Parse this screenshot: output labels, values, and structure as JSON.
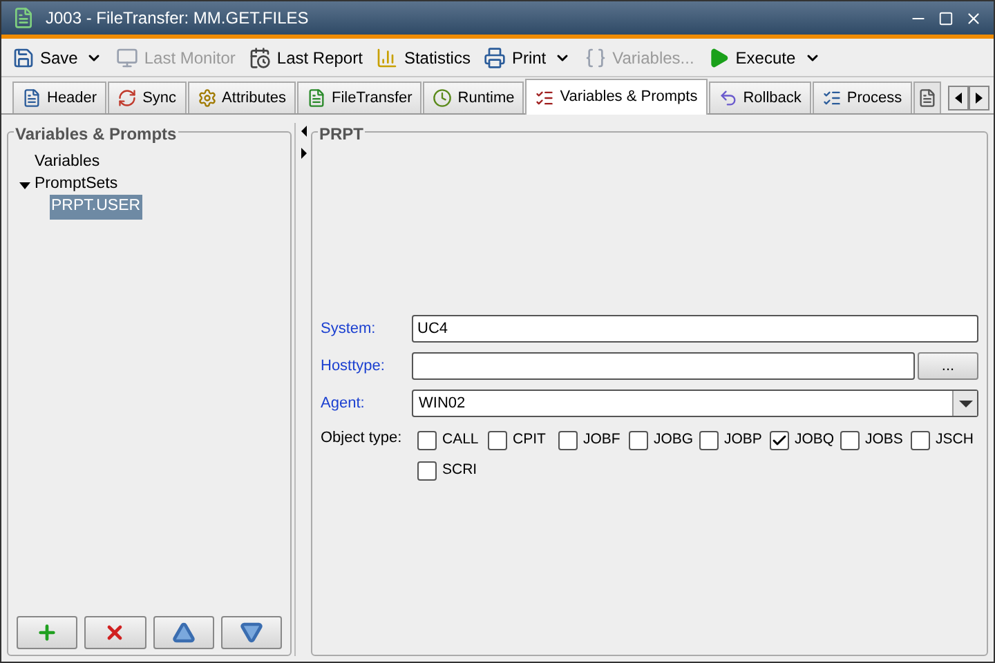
{
  "window": {
    "title": "J003 - FileTransfer: MM.GET.FILES"
  },
  "toolbar": [
    {
      "label": "Save",
      "disabled": false,
      "dropdown": true,
      "kind": "save"
    },
    {
      "label": "Last Monitor",
      "disabled": true,
      "dropdown": false,
      "kind": "monitor"
    },
    {
      "label": "Last Report",
      "disabled": false,
      "dropdown": false,
      "kind": "report"
    },
    {
      "label": "Statistics",
      "disabled": false,
      "dropdown": false,
      "kind": "stats"
    },
    {
      "label": "Print",
      "disabled": false,
      "dropdown": true,
      "kind": "print"
    },
    {
      "label": "Variables...",
      "disabled": true,
      "dropdown": false,
      "kind": "vars"
    },
    {
      "label": "Execute",
      "disabled": false,
      "dropdown": true,
      "kind": "execute"
    }
  ],
  "tabs": [
    {
      "label": "Header",
      "selected": false
    },
    {
      "label": "Sync",
      "selected": false
    },
    {
      "label": "Attributes",
      "selected": false
    },
    {
      "label": "FileTransfer",
      "selected": false
    },
    {
      "label": "Runtime",
      "selected": false
    },
    {
      "label": "Variables & Prompts",
      "selected": true
    },
    {
      "label": "Rollback",
      "selected": false
    },
    {
      "label": "Process",
      "selected": false
    }
  ],
  "left_panel": {
    "title": "Variables & Prompts",
    "tree": [
      {
        "label": "Variables",
        "selected": false
      },
      {
        "label": "PromptSets",
        "selected": false,
        "expanded": true,
        "children": [
          {
            "label": "PRPT.USER",
            "selected": true
          }
        ]
      }
    ]
  },
  "right_panel": {
    "title": "PRPT",
    "fields": [
      {
        "label": "System:",
        "kind": "text",
        "value": "UC4",
        "required": true
      },
      {
        "label": "Hosttype:",
        "kind": "browse",
        "button": "...",
        "required": true
      },
      {
        "label": "Agent:",
        "kind": "select",
        "value": "WIN02",
        "required": true
      }
    ],
    "object_type": {
      "label": "Object type:",
      "options": [
        {
          "label": "CALL",
          "checked": false
        },
        {
          "label": "CPIT",
          "checked": false
        },
        {
          "label": "JOBF",
          "checked": false
        },
        {
          "label": "JOBG",
          "checked": false
        },
        {
          "label": "JOBP",
          "checked": false
        },
        {
          "label": "JOBQ",
          "checked": true
        },
        {
          "label": "JOBS",
          "checked": false
        },
        {
          "label": "JSCH",
          "checked": false
        },
        {
          "label": "SCRI",
          "checked": false
        }
      ]
    }
  }
}
